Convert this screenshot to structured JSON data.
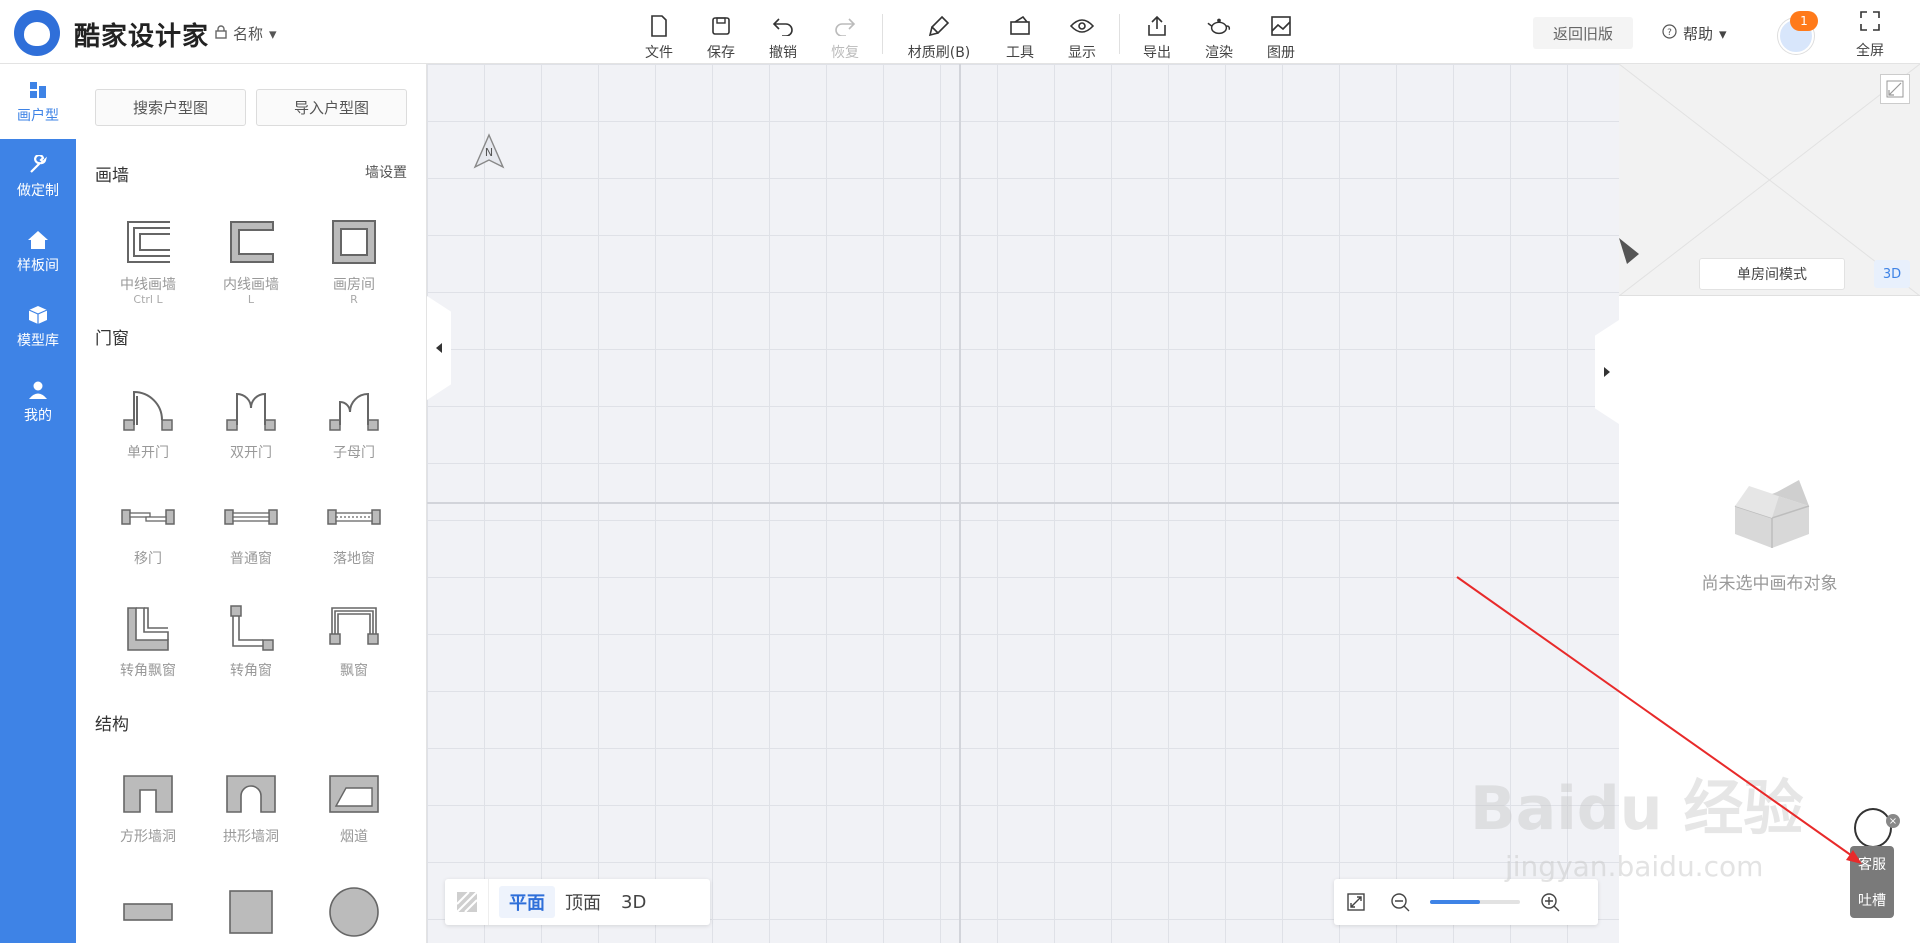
{
  "header": {
    "brand": "酷家设计家",
    "name_label": "名称",
    "tools": [
      {
        "label": "文件",
        "icon": "file-icon",
        "disabled": false
      },
      {
        "label": "保存",
        "icon": "save-icon",
        "disabled": false
      },
      {
        "label": "撤销",
        "icon": "undo-icon",
        "disabled": false
      },
      {
        "label": "恢复",
        "icon": "redo-icon",
        "disabled": true
      },
      {
        "label": "材质刷(B)",
        "icon": "brush-icon",
        "disabled": false
      },
      {
        "label": "工具",
        "icon": "tool-icon",
        "disabled": false
      },
      {
        "label": "显示",
        "icon": "eye-icon",
        "disabled": false
      },
      {
        "label": "导出",
        "icon": "export-icon",
        "disabled": false
      },
      {
        "label": "渲染",
        "icon": "teapot-icon",
        "disabled": false
      },
      {
        "label": "图册",
        "icon": "album-icon",
        "disabled": false
      }
    ],
    "old_version": "返回旧版",
    "help": "帮助",
    "badge_count": "1",
    "fullscreen": "全屏"
  },
  "sidebar": {
    "items": [
      {
        "label": "画户型",
        "active": true
      },
      {
        "label": "做定制",
        "active": false
      },
      {
        "label": "样板间",
        "active": false
      },
      {
        "label": "模型库",
        "active": false
      },
      {
        "label": "我的",
        "active": false
      }
    ]
  },
  "panel": {
    "search_btn": "搜索户型图",
    "import_btn": "导入户型图",
    "wall_title": "画墙",
    "wall_settings": "墙设置",
    "wall_items": [
      {
        "label": "中线画墙",
        "hotkey": "Ctrl L"
      },
      {
        "label": "内线画墙",
        "hotkey": "L"
      },
      {
        "label": "画房间",
        "hotkey": "R"
      }
    ],
    "door_title": "门窗",
    "door_items": [
      {
        "label": "单开门"
      },
      {
        "label": "双开门"
      },
      {
        "label": "子母门"
      },
      {
        "label": "移门"
      },
      {
        "label": "普通窗"
      },
      {
        "label": "落地窗"
      },
      {
        "label": "转角飘窗"
      },
      {
        "label": "转角窗"
      },
      {
        "label": "飘窗"
      }
    ],
    "struct_title": "结构",
    "struct_items": [
      {
        "label": "方形墙洞"
      },
      {
        "label": "拱形墙洞"
      },
      {
        "label": "烟道"
      }
    ]
  },
  "canvas": {
    "compass_label": "N",
    "views": [
      "平面",
      "顶面",
      "3D"
    ],
    "active_view": "平面",
    "zoom_level": 0.55
  },
  "right_panel": {
    "mode_btn": "单房间模式",
    "btn_3d": "3D",
    "empty_text": "尚未选中画布对象"
  },
  "watermark": {
    "main": "Baidu 经验",
    "sub": "jingyan.baidu.com"
  },
  "support": {
    "line1": "客服",
    "line2": "吐槽"
  },
  "colors": {
    "accent": "#3e83e6",
    "annotation_arrow": "#e82a2a",
    "badge": "#ff7a1a"
  }
}
